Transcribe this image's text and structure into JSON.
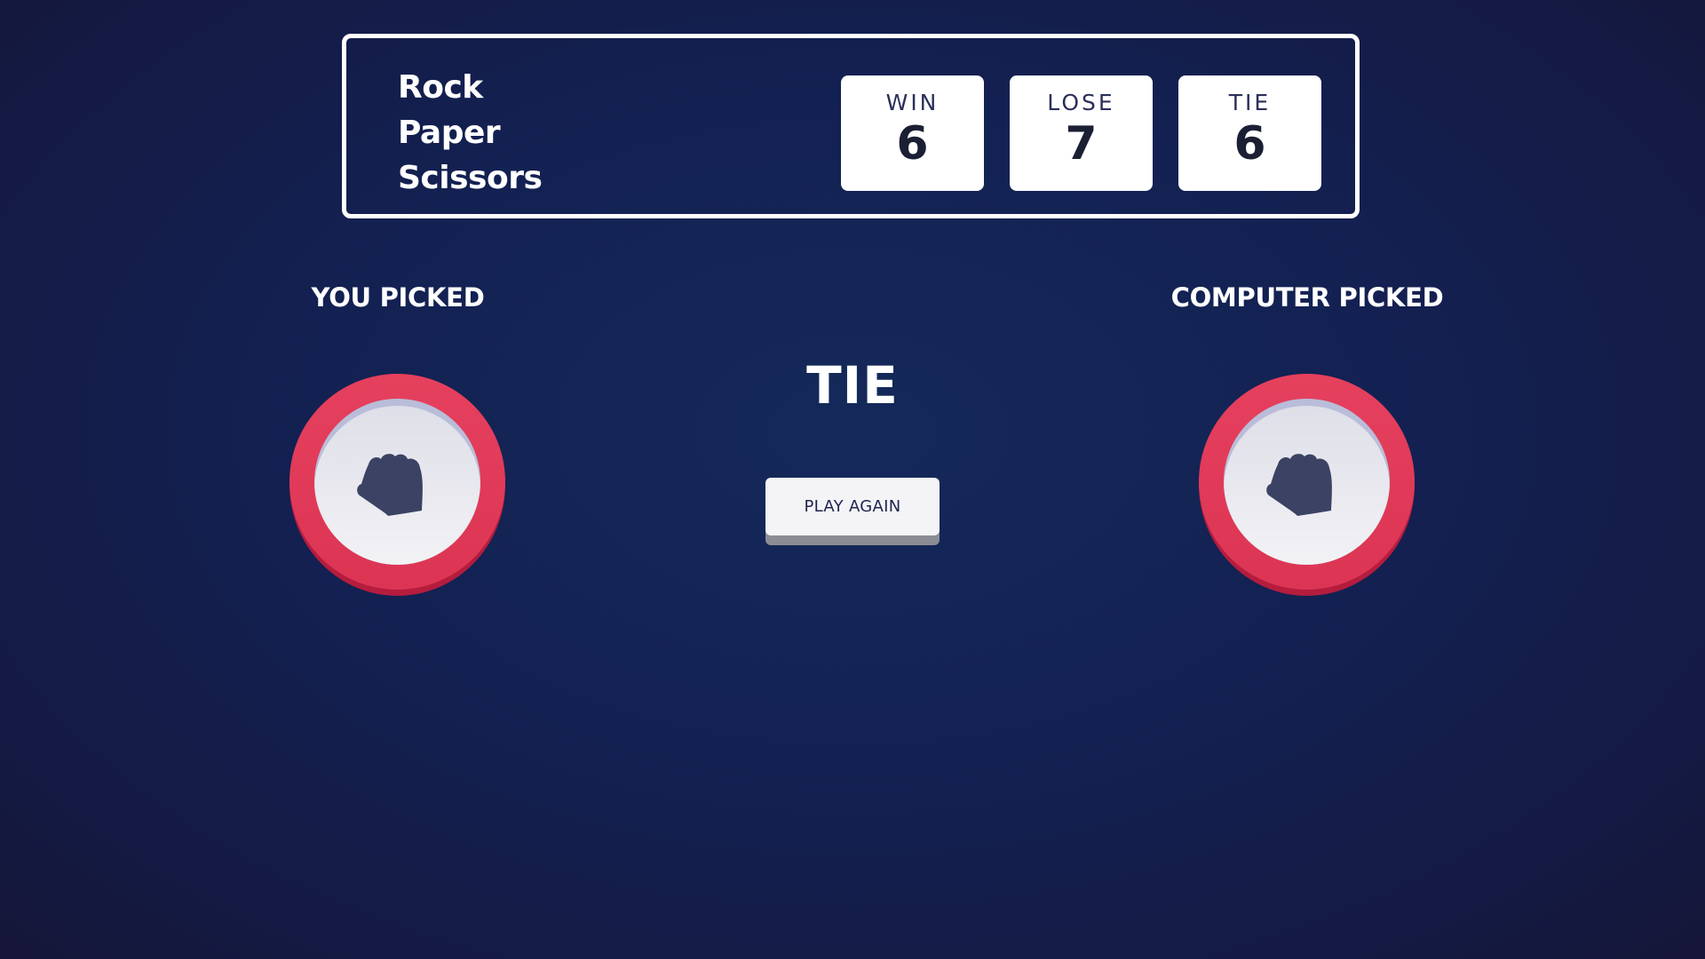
{
  "game": {
    "title_lines": [
      "Rock",
      "Paper",
      "Scissors"
    ]
  },
  "score": {
    "win": {
      "label": "WIN",
      "value": "6"
    },
    "lose": {
      "label": "LOSE",
      "value": "7"
    },
    "tie": {
      "label": "TIE",
      "value": "6"
    }
  },
  "player": {
    "label": "YOU PICKED",
    "pick": "rock",
    "icon": "fist-icon",
    "ring_color": "#dc3554"
  },
  "computer": {
    "label": "COMPUTER PICKED",
    "pick": "rock",
    "icon": "fist-icon",
    "ring_color": "#dc3554"
  },
  "result": {
    "text": "TIE"
  },
  "actions": {
    "play_again_label": "PLAY AGAIN"
  },
  "colors": {
    "background": "#132152",
    "accent_rock": "#dc3554",
    "icon": "#3b4263"
  }
}
